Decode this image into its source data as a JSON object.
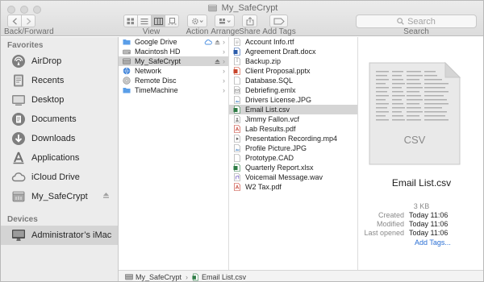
{
  "window": {
    "title": "My_SafeCrypt"
  },
  "toolbar": {
    "back_forward_label": "Back/Forward",
    "view_label": "View",
    "action_label": "Action",
    "arrange_label": "Arrange",
    "share_label": "Share",
    "add_tags_label": "Add Tags",
    "search_label": "Search",
    "search_placeholder": "Search"
  },
  "sidebar": {
    "favorites_header": "Favorites",
    "favorites": [
      {
        "label": "AirDrop",
        "icon": "airdrop-icon"
      },
      {
        "label": "Recents",
        "icon": "recents-icon"
      },
      {
        "label": "Desktop",
        "icon": "desktop-icon"
      },
      {
        "label": "Documents",
        "icon": "documents-icon"
      },
      {
        "label": "Downloads",
        "icon": "downloads-icon"
      },
      {
        "label": "Applications",
        "icon": "applications-icon"
      },
      {
        "label": "iCloud Drive",
        "icon": "cloud-icon"
      },
      {
        "label": "My_SafeCrypt",
        "icon": "drive-icon"
      }
    ],
    "devices_header": "Devices",
    "devices": [
      {
        "label": "Administrator’s iMac",
        "icon": "imac-icon"
      }
    ]
  },
  "column1": {
    "items": [
      {
        "label": "Google Drive",
        "icon": "folder-icon"
      },
      {
        "label": "Macintosh HD",
        "icon": "hard-drive-icon"
      },
      {
        "label": "My_SafeCrypt",
        "icon": "drive-icon"
      },
      {
        "label": "Network",
        "icon": "network-icon"
      },
      {
        "label": "Remote Disc",
        "icon": "disc-icon"
      },
      {
        "label": "TimeMachine",
        "icon": "folder-icon"
      }
    ]
  },
  "column2": {
    "items": [
      {
        "label": "Account Info.rtf",
        "icon": "rtf-file-icon"
      },
      {
        "label": "Agreement Draft.docx",
        "icon": "word-file-icon"
      },
      {
        "label": "Backup.zip",
        "icon": "zip-file-icon"
      },
      {
        "label": "Client Proposal.pptx",
        "icon": "powerpoint-file-icon"
      },
      {
        "label": "Database.SQL",
        "icon": "file-icon"
      },
      {
        "label": "Debriefing.emlx",
        "icon": "mail-file-icon"
      },
      {
        "label": "Drivers License.JPG",
        "icon": "image-file-icon"
      },
      {
        "label": "Email List.csv",
        "icon": "excel-file-icon"
      },
      {
        "label": "Jimmy Fallon.vcf",
        "icon": "contact-file-icon"
      },
      {
        "label": "Lab Results.pdf",
        "icon": "pdf-file-icon"
      },
      {
        "label": "Presentation Recording.mp4",
        "icon": "video-file-icon"
      },
      {
        "label": "Profile Picture.JPG",
        "icon": "image-file-icon"
      },
      {
        "label": "Prototype.CAD",
        "icon": "file-icon"
      },
      {
        "label": "Quarterly Report.xlsx",
        "icon": "excel-file-icon"
      },
      {
        "label": "Voicemail Message.wav",
        "icon": "audio-file-icon"
      },
      {
        "label": "W2 Tax.pdf",
        "icon": "pdf-file-icon"
      }
    ]
  },
  "preview": {
    "thumbnail_label": "CSV",
    "file_name": "Email List.csv",
    "size": "3 KB",
    "created_label": "Created",
    "created_value": "Today  11:06",
    "modified_label": "Modified",
    "modified_value": "Today  11:06",
    "last_opened_label": "Last opened",
    "last_opened_value": "Today  11:06",
    "add_tags_link": "Add Tags..."
  },
  "pathbar": {
    "segments": [
      "My_SafeCrypt",
      "Email List.csv"
    ]
  },
  "colors": {
    "selection": "#d5d5d5",
    "link": "#2a6fd4",
    "sidebar_bg": "#ececec"
  }
}
